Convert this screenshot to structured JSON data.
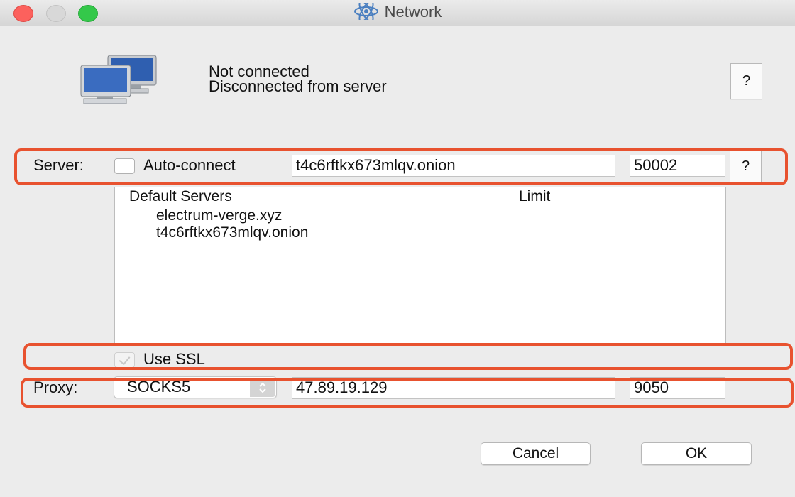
{
  "window": {
    "title": "Network"
  },
  "status": {
    "line1": "Not connected",
    "line2": "Disconnected from server",
    "help_label": "?"
  },
  "server": {
    "label": "Server:",
    "auto_connect_label": "Auto-connect",
    "auto_connect_checked": false,
    "host": "t4c6rftkx673mlqv.onion",
    "port": "50002",
    "help_label": "?"
  },
  "server_list": {
    "columns": [
      "Default Servers",
      "Limit"
    ],
    "items": [
      "electrum-verge.xyz",
      "t4c6rftkx673mlqv.onion"
    ]
  },
  "ssl": {
    "label": "Use SSL",
    "checked": true,
    "enabled": false
  },
  "proxy": {
    "label": "Proxy:",
    "type": "SOCKS5",
    "host": "47.89.19.129",
    "port": "9050"
  },
  "buttons": {
    "cancel": "Cancel",
    "ok": "OK"
  },
  "colors": {
    "highlight": "#e8522f",
    "close": "#fc615d",
    "zoom": "#34c84a"
  }
}
